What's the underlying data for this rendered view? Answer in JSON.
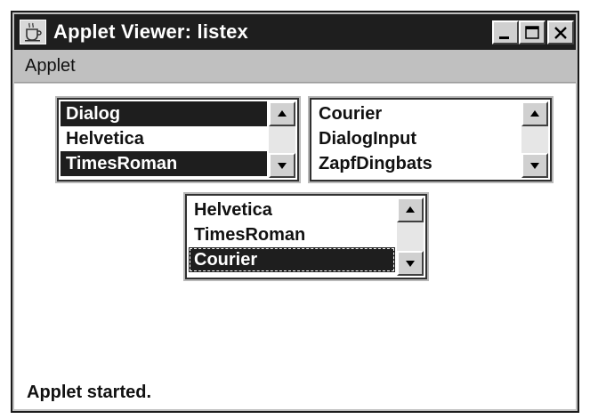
{
  "window": {
    "title": "Applet Viewer: listex",
    "icon": "java-cup-icon"
  },
  "menubar": {
    "items": [
      "Applet"
    ]
  },
  "lists": [
    {
      "items": [
        {
          "label": "Dialog",
          "selected": true
        },
        {
          "label": "Helvetica",
          "selected": false
        },
        {
          "label": "TimesRoman",
          "selected": true
        }
      ]
    },
    {
      "items": [
        {
          "label": "Courier",
          "selected": false
        },
        {
          "label": "DialogInput",
          "selected": false
        },
        {
          "label": "ZapfDingbats",
          "selected": false
        }
      ]
    },
    {
      "items": [
        {
          "label": "Helvetica",
          "selected": false
        },
        {
          "label": "TimesRoman",
          "selected": false
        },
        {
          "label": "Courier",
          "selected": true
        }
      ]
    }
  ],
  "status": {
    "text": "Applet started."
  }
}
